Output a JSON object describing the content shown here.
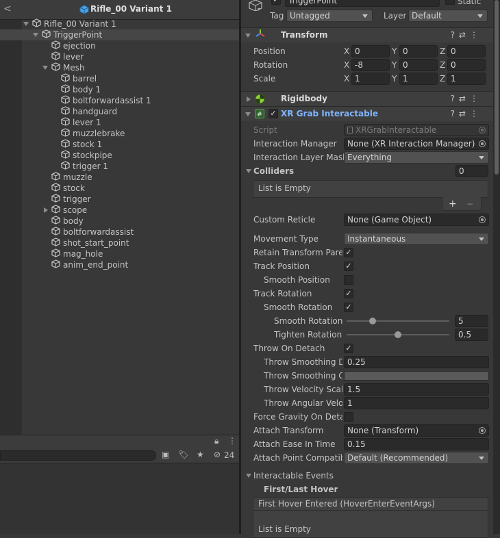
{
  "hierarchy": {
    "title": "Rifle_00 Variant 1",
    "back_label": "<",
    "root": "Rifle_00 Variant 1",
    "selected": "TriggerPoint",
    "items_l2": [
      "ejection",
      "lever"
    ],
    "mesh": "Mesh",
    "mesh_children": [
      "barrel",
      "body 1",
      "boltforwardassist 1",
      "handguard",
      "lever 1",
      "muzzlebrake",
      "stock 1",
      "stockpipe",
      "trigger 1"
    ],
    "items_after": [
      "muzzle",
      "stock",
      "trigger"
    ],
    "scope": "scope",
    "items_tail": [
      "body",
      "boltforwardassist",
      "shot_start_point",
      "mag_hole",
      "anim_end_point"
    ],
    "hidden_count": "24"
  },
  "inspector": {
    "object_name": "TriggerPoint",
    "static_label": "Static",
    "tag_label": "Tag",
    "tag_value": "Untagged",
    "layer_label": "Layer",
    "layer_value": "Default",
    "transform": {
      "title": "Transform",
      "position_label": "Position",
      "rotation_label": "Rotation",
      "scale_label": "Scale",
      "position": [
        "0",
        "0",
        "0"
      ],
      "rotation": [
        "-8",
        "0",
        "0"
      ],
      "scale": [
        "1",
        "1",
        "1"
      ],
      "axes": [
        "X",
        "Y",
        "Z"
      ]
    },
    "rigidbody_title": "Rigidbody",
    "xr": {
      "title": "XR Grab Interactable",
      "script_label": "Script",
      "script_value": "XRGrabInteractable",
      "interaction_manager_label": "Interaction Manager",
      "interaction_manager_value": "None (XR Interaction Manager)",
      "layer_mask_label": "Interaction Layer Mask",
      "layer_mask_value": "Everything",
      "colliders_label": "Colliders",
      "colliders_count": "0",
      "list_empty": "List is Empty",
      "plus": "+",
      "minus": "−",
      "custom_reticle_label": "Custom Reticle",
      "custom_reticle_value": "None (Game Object)",
      "movement_type_label": "Movement Type",
      "movement_type_value": "Instantaneous",
      "retain_label": "Retain Transform Paren",
      "track_position_label": "Track Position",
      "smooth_position_label": "Smooth Position",
      "track_rotation_label": "Track Rotation",
      "smooth_rotation_label": "Smooth Rotation",
      "smooth_rotation_amount_label": "Smooth Rotation A",
      "smooth_rotation_amount": "5",
      "smooth_rotation_fraction": 0.25,
      "tighten_rotation_label": "Tighten Rotation",
      "tighten_rotation": "0.5",
      "tighten_rotation_fraction": 0.5,
      "throw_on_detach_label": "Throw On Detach",
      "throw_smoothing_duration_label": "Throw Smoothing Du",
      "throw_smoothing_duration": "0.25",
      "throw_smoothing_curve_label": "Throw Smoothing Cu",
      "throw_velocity_label": "Throw Velocity Scale",
      "throw_velocity": "1.5",
      "throw_angular_label": "Throw Angular Veloc",
      "throw_angular": "1",
      "force_gravity_label": "Force Gravity On Detac",
      "attach_transform_label": "Attach Transform",
      "attach_transform_value": "None (Transform)",
      "attach_ease_label": "Attach Ease In Time",
      "attach_ease_value": "0.15",
      "attach_point_label": "Attach Point Compatibi",
      "attach_point_value": "Default (Recommended)",
      "events_label": "Interactable Events",
      "first_last_hover_label": "First/Last Hover",
      "first_hover_entered_label": "First Hover Entered (HoverEnterEventArgs)",
      "list_empty_2": "List is Empty"
    }
  },
  "colors": {
    "accent_link": "#7fb5ff",
    "selected_row": "#464646",
    "rigidbody_icon": "#8cd33c"
  }
}
